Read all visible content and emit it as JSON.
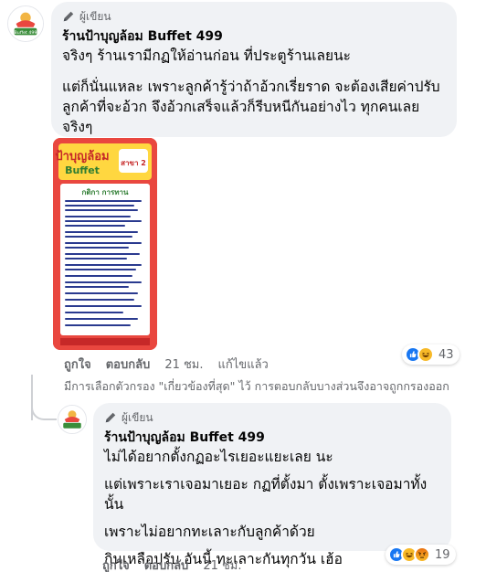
{
  "comment": {
    "badge": "ผู้เขียน",
    "author": "ร้านป้าบุญล้อม Buffet 499",
    "lines": [
      "จริงๆ ร้านเรามีกฏให้อ่านก่อน ที่ประตูร้านเลยนะ",
      "แต่ก็นั่นแหละ เพราะลูกค้ารู้ว่าถ้าอ้วกเรี่ยราด จะต้องเสียค่าปรับ",
      "ลูกค้าที่จะอ้วก จึงอ้วกเสร็จแล้วก็รีบหนีกันอย่างไว ทุกคนเลย",
      "จริงๆ"
    ],
    "avatar_logo_text": "Buffet 499",
    "image": {
      "heading": "ป้าบุญล้อม",
      "subheading": "Buffet",
      "branch": "สาขา 2",
      "rules_title": "กติกา การทาน"
    },
    "actions": {
      "like": "ถูกใจ",
      "reply": "ตอบกลับ",
      "time": "21 ชม.",
      "edited": "แก้ไขแล้ว"
    },
    "reactions": {
      "count": "43",
      "icons": [
        "like-icon",
        "laugh-icon"
      ]
    }
  },
  "filter_note": "มีการเลือกตัวกรอง \"เกี่ยวข้องที่สุด\" ไว้ การตอบกลับบางส่วนจึงอาจถูกกรองออก",
  "reply": {
    "badge": "ผู้เขียน",
    "author": "ร้านป้าบุญล้อม Buffet 499",
    "lines": [
      "ไม่ได้อยากตั้งกฏอะไรเยอะแยะเลย นะ",
      "แต่เพราะเราเจอมาเยอะ กฏที่ตั้งมา ตั้งเพราะเจอมาทั้งนั้น",
      "เพราะไม่อยากทะเลาะกับลูกค้าด้วย",
      "กินเหลือปรับ อันนี้ ทะเลาะกันทุกวัน เฮ้อ"
    ],
    "actions": {
      "like": "ถูกใจ",
      "reply": "ตอบกลับ",
      "time": "21 ชม."
    },
    "reactions": {
      "count": "19",
      "icons": [
        "like-icon",
        "laugh-icon",
        "angry-icon"
      ]
    }
  },
  "colors": {
    "bubble": "#f0f2f5",
    "muted_text": "#65676b",
    "like_blue": "#1877f2",
    "laugh_yellow": "#f7b928",
    "angry_orange": "#e9710f",
    "poster_red": "#e9473f"
  }
}
